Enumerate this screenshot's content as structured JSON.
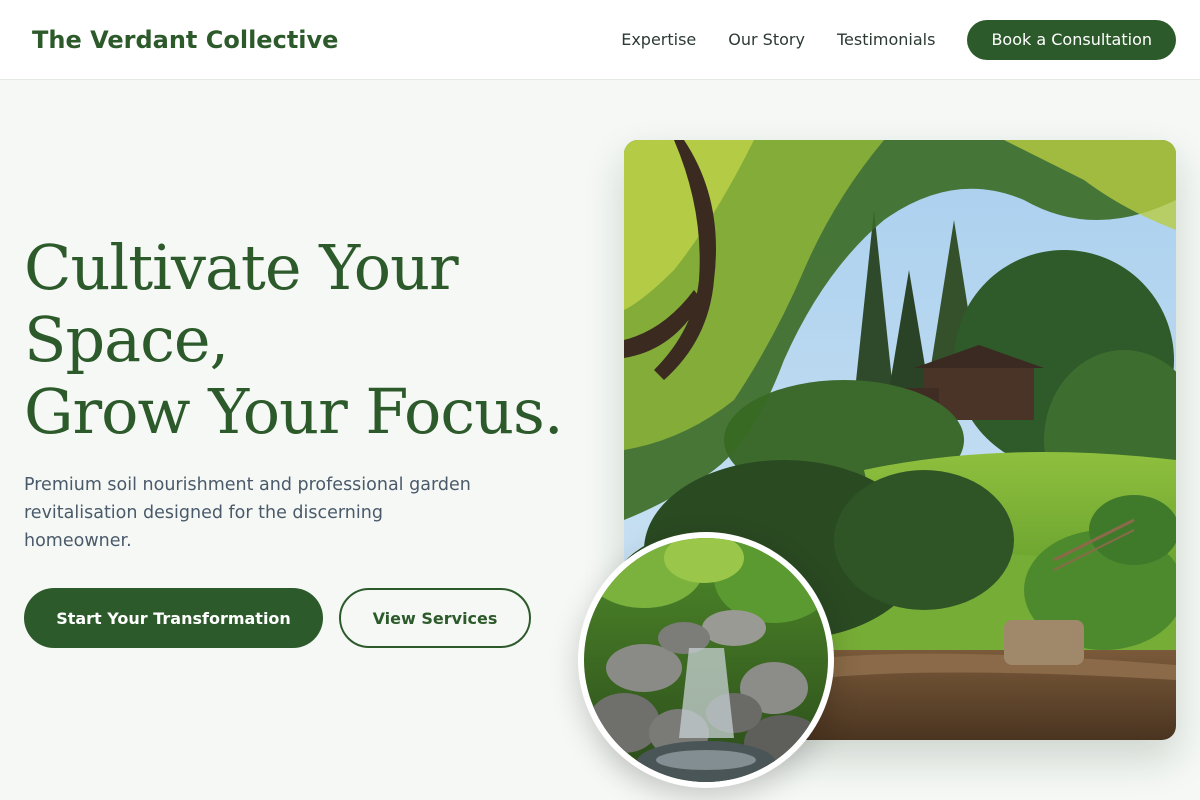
{
  "nav": {
    "brand": "The Verdant Collective",
    "links": [
      "Expertise",
      "Our Story",
      "Testimonials"
    ],
    "cta": "Book a Consultation"
  },
  "hero": {
    "headline": [
      "Cultivate Your",
      "Space,",
      "Grow Your Focus."
    ],
    "subtext": "Premium soil nourishment and professional garden revitalisation designed for the discerning homeowner.",
    "primary_button": "Start Your Transformation",
    "secondary_button": "View Services"
  },
  "images": {
    "main": "garden-landscape-photo",
    "inset": "rock-waterfall-photo"
  },
  "colors": {
    "brand_green": "#2d5a2b",
    "text_muted": "#4a5a6a",
    "background": "#f5f8f5"
  }
}
